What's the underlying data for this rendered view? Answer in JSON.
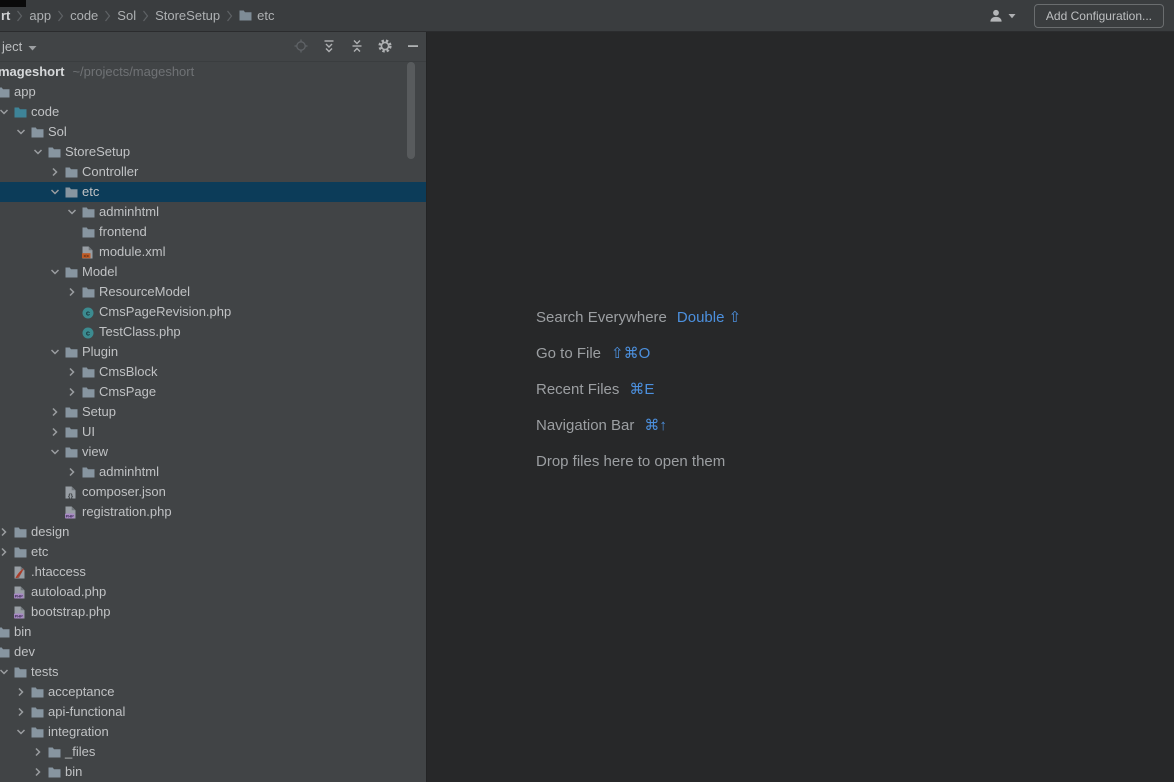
{
  "topbar": {
    "breadcrumbs": [
      {
        "label": "rt",
        "bold": true
      },
      {
        "label": "app"
      },
      {
        "label": "code"
      },
      {
        "label": "Sol"
      },
      {
        "label": "StoreSetup"
      },
      {
        "label": "etc",
        "icon": "folder"
      }
    ],
    "user_icon": "user-icon",
    "add_configuration_label": "Add Configuration..."
  },
  "project_panel": {
    "title": "ject",
    "header_icons": [
      "locate",
      "expand-all",
      "collapse-all",
      "gear",
      "minus"
    ],
    "root": {
      "name": "mageshort",
      "path": "~/projects/mageshort"
    },
    "tree": [
      {
        "label": "app",
        "level": 1,
        "icon": "folder",
        "chevron": "expanded"
      },
      {
        "label": "code",
        "level": 2,
        "icon": "folder-source",
        "chevron": "expanded"
      },
      {
        "label": "Sol",
        "level": 3,
        "icon": "folder",
        "chevron": "expanded"
      },
      {
        "label": "StoreSetup",
        "level": 4,
        "icon": "folder",
        "chevron": "expanded"
      },
      {
        "label": "Controller",
        "level": 5,
        "icon": "folder",
        "chevron": "collapsed"
      },
      {
        "label": "etc",
        "level": 5,
        "icon": "folder",
        "chevron": "expanded",
        "selected": true
      },
      {
        "label": "adminhtml",
        "level": 6,
        "icon": "folder",
        "chevron": "expanded"
      },
      {
        "label": "frontend",
        "level": 6,
        "icon": "folder",
        "chevron": null
      },
      {
        "label": "module.xml",
        "level": 6,
        "icon": "file-xml",
        "chevron": null
      },
      {
        "label": "Model",
        "level": 5,
        "icon": "folder",
        "chevron": "expanded"
      },
      {
        "label": "ResourceModel",
        "level": 6,
        "icon": "folder",
        "chevron": "collapsed"
      },
      {
        "label": "CmsPageRevision.php",
        "level": 6,
        "icon": "class-php",
        "chevron": null
      },
      {
        "label": "TestClass.php",
        "level": 6,
        "icon": "class-php",
        "chevron": null
      },
      {
        "label": "Plugin",
        "level": 5,
        "icon": "folder",
        "chevron": "expanded"
      },
      {
        "label": "CmsBlock",
        "level": 6,
        "icon": "folder",
        "chevron": "collapsed"
      },
      {
        "label": "CmsPage",
        "level": 6,
        "icon": "folder",
        "chevron": "collapsed"
      },
      {
        "label": "Setup",
        "level": 5,
        "icon": "folder",
        "chevron": "collapsed"
      },
      {
        "label": "UI",
        "level": 5,
        "icon": "folder",
        "chevron": "collapsed"
      },
      {
        "label": "view",
        "level": 5,
        "icon": "folder",
        "chevron": "expanded"
      },
      {
        "label": "adminhtml",
        "level": 6,
        "icon": "folder",
        "chevron": "collapsed"
      },
      {
        "label": "composer.json",
        "level": 5,
        "icon": "file-json",
        "chevron": null
      },
      {
        "label": "registration.php",
        "level": 5,
        "icon": "file-php",
        "chevron": null
      },
      {
        "label": "design",
        "level": 2,
        "icon": "folder",
        "chevron": "collapsed"
      },
      {
        "label": "etc",
        "level": 2,
        "icon": "folder",
        "chevron": "collapsed"
      },
      {
        "label": ".htaccess",
        "level": 2,
        "icon": "file-htaccess",
        "chevron": null
      },
      {
        "label": "autoload.php",
        "level": 2,
        "icon": "file-php",
        "chevron": null
      },
      {
        "label": "bootstrap.php",
        "level": 2,
        "icon": "file-php",
        "chevron": null
      },
      {
        "label": "bin",
        "level": 1,
        "icon": "folder",
        "chevron": "collapsed"
      },
      {
        "label": "dev",
        "level": 1,
        "icon": "folder",
        "chevron": "expanded"
      },
      {
        "label": "tests",
        "level": 2,
        "icon": "folder",
        "chevron": "expanded"
      },
      {
        "label": "acceptance",
        "level": 3,
        "icon": "folder",
        "chevron": "collapsed"
      },
      {
        "label": "api-functional",
        "level": 3,
        "icon": "folder",
        "chevron": "collapsed"
      },
      {
        "label": "integration",
        "level": 3,
        "icon": "folder",
        "chevron": "expanded"
      },
      {
        "label": "_files",
        "level": 4,
        "icon": "folder",
        "chevron": "collapsed"
      },
      {
        "label": "bin",
        "level": 4,
        "icon": "folder",
        "chevron": "collapsed"
      }
    ]
  },
  "editor": {
    "shortcuts": [
      {
        "label": "Search Everywhere",
        "keys": "Double ⇧"
      },
      {
        "label": "Go to File",
        "keys": "⇧⌘O"
      },
      {
        "label": "Recent Files",
        "keys": "⌘E"
      },
      {
        "label": "Navigation Bar",
        "keys": "⌘↑"
      },
      {
        "label": "Drop files here to open them",
        "keys": ""
      }
    ]
  },
  "colors": {
    "accent_blue": "#4C90DE",
    "selection": "#0C3C59",
    "folder": "#8795A0",
    "folder_source": "#3E8498",
    "folder_breadcrumb": "#7E8C96",
    "class_icon": "#3C8B90",
    "xml_badge": "#BE5B26",
    "php_badge": "#A98BC5",
    "apache_red": "#CE4B33"
  }
}
